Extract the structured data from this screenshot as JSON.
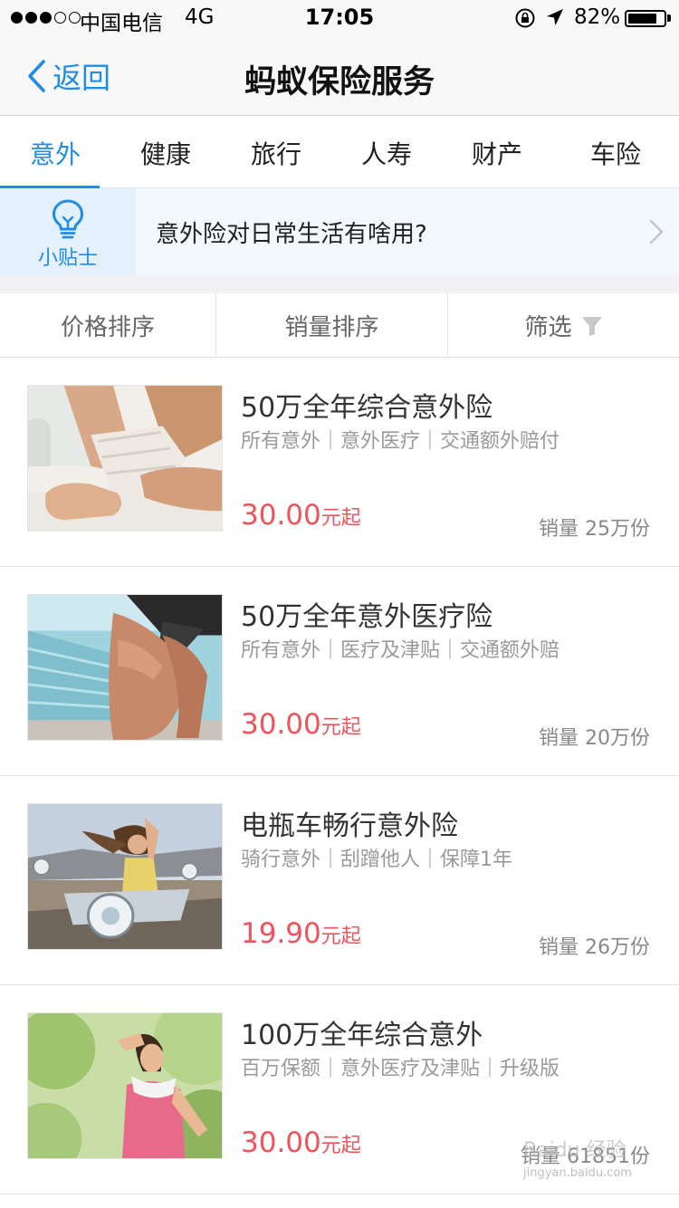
{
  "status_bar": {
    "carrier": "中国电信",
    "network": "4G",
    "time": "17:05",
    "battery_percent": "82%",
    "battery_level": 0.82,
    "signal_bars": 3,
    "signal_total": 5,
    "icons": [
      "orientation-lock-icon",
      "location-arrow-icon",
      "battery-icon"
    ]
  },
  "nav": {
    "back_label": "返回",
    "title": "蚂蚁保险服务",
    "accent_color": "#1f8ce8"
  },
  "tabs": [
    {
      "label": "意外",
      "active": true
    },
    {
      "label": "健康",
      "active": false
    },
    {
      "label": "旅行",
      "active": false
    },
    {
      "label": "人寿",
      "active": false
    },
    {
      "label": "财产",
      "active": false
    },
    {
      "label": "车险",
      "active": false
    }
  ],
  "tip": {
    "badge_label": "小贴士",
    "text": "意外险对日常生活有啥用?",
    "icon": "lightbulb-icon"
  },
  "sort_bar": {
    "price_sort": "价格排序",
    "sales_sort": "销量排序",
    "filter": "筛选",
    "filter_icon": "funnel-icon"
  },
  "products": [
    {
      "name": "50万全年综合意外险",
      "tags": "所有意外｜意外医疗｜交通额外赔付",
      "price": "30.00",
      "price_unit": "元起",
      "sales": "销量 25万份",
      "image": "bandaged-ankle-photo"
    },
    {
      "name": "50万全年意外医疗险",
      "tags": "所有意外｜医疗及津贴｜交通额外赔",
      "price": "30.00",
      "price_unit": "元起",
      "sales": "销量 20万份",
      "image": "injured-knee-photo"
    },
    {
      "name": "电瓶车畅行意外险",
      "tags": "骑行意外｜刮蹭他人｜保障1年",
      "price": "19.90",
      "price_unit": "元起",
      "sales": "销量 26万份",
      "image": "woman-on-scooter-photo"
    },
    {
      "name": "100万全年综合意外",
      "tags": "百万保额｜意外医疗及津贴｜升级版",
      "price": "30.00",
      "price_unit": "元起",
      "sales": "销量 61851份",
      "image": "woman-exercising-photo"
    }
  ],
  "price_color": "#f0535b",
  "watermark": {
    "top": "Baidu 经验",
    "bottom": "jingyan.baidu.com"
  }
}
